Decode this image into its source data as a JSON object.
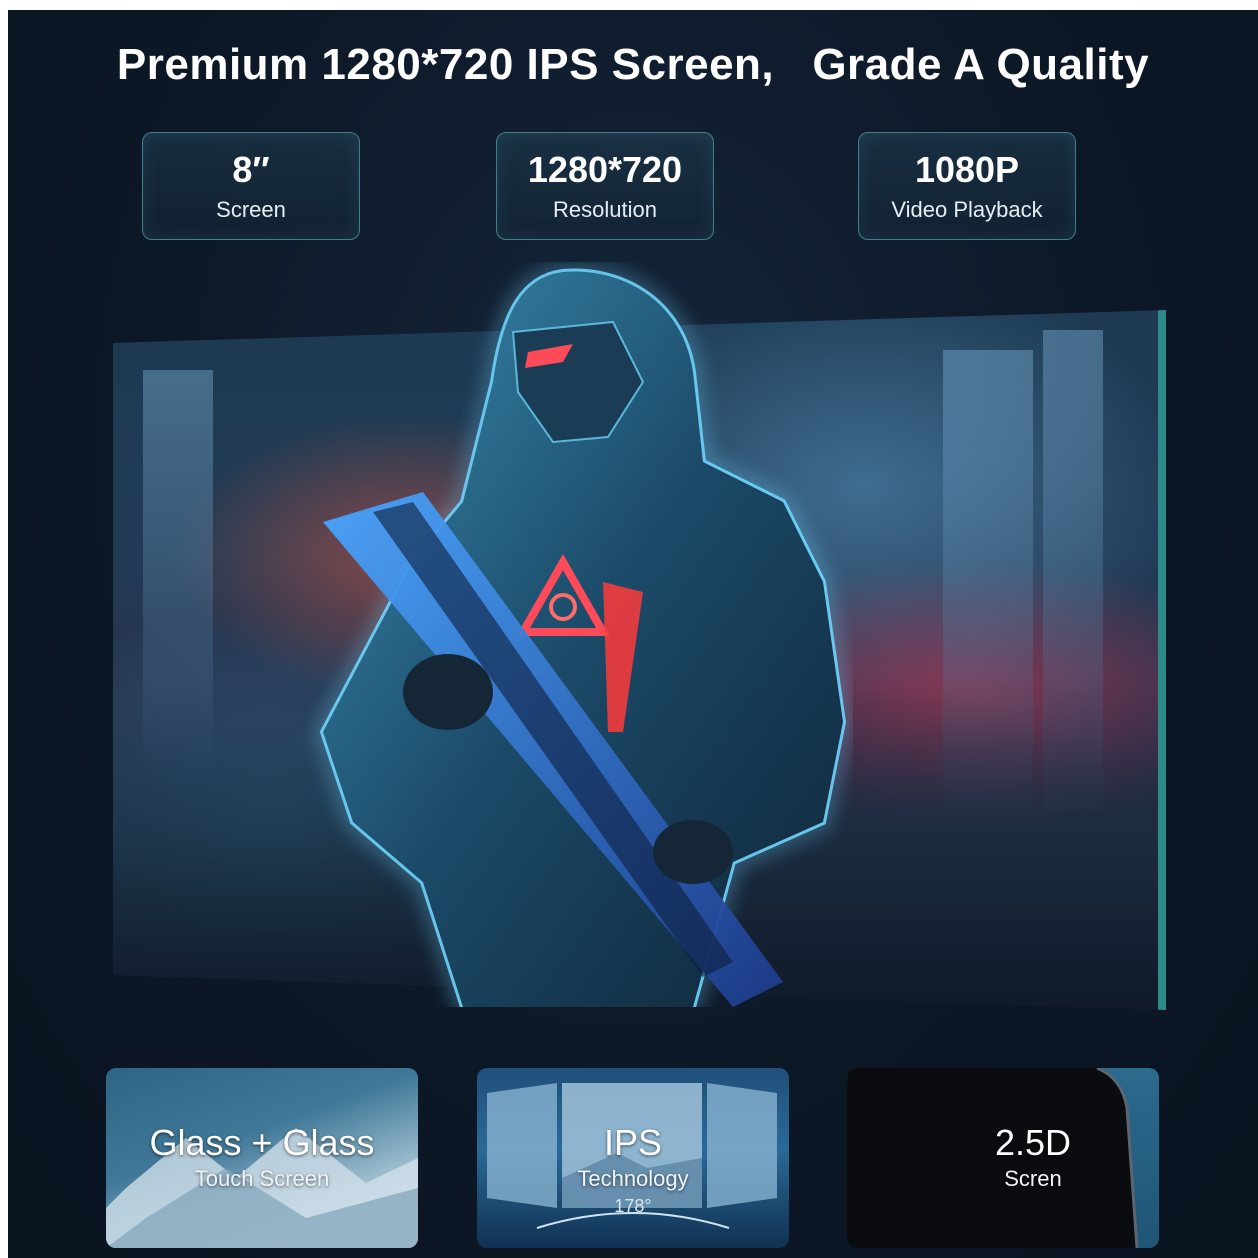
{
  "headline": "Premium 1280*720 IPS Screen,   Grade A Quality",
  "specs": [
    {
      "value": "8″",
      "label": "Screen"
    },
    {
      "value": "1280*720",
      "label": "Resolution"
    },
    {
      "value": "1080P",
      "label": "Video Playback"
    }
  ],
  "features": [
    {
      "title": "Glass + Glass",
      "subtitle": "Touch Screen"
    },
    {
      "title": "IPS",
      "subtitle": "Technology",
      "angle": "178°"
    },
    {
      "title": "2.5D",
      "subtitle": "Scren"
    }
  ],
  "colors": {
    "background": "#0d1827",
    "card_border": "#3f7f8e",
    "screen_edge": "#2d8a8a",
    "glow": "#6fd6ff",
    "accent_red": "#ff4a5a"
  }
}
